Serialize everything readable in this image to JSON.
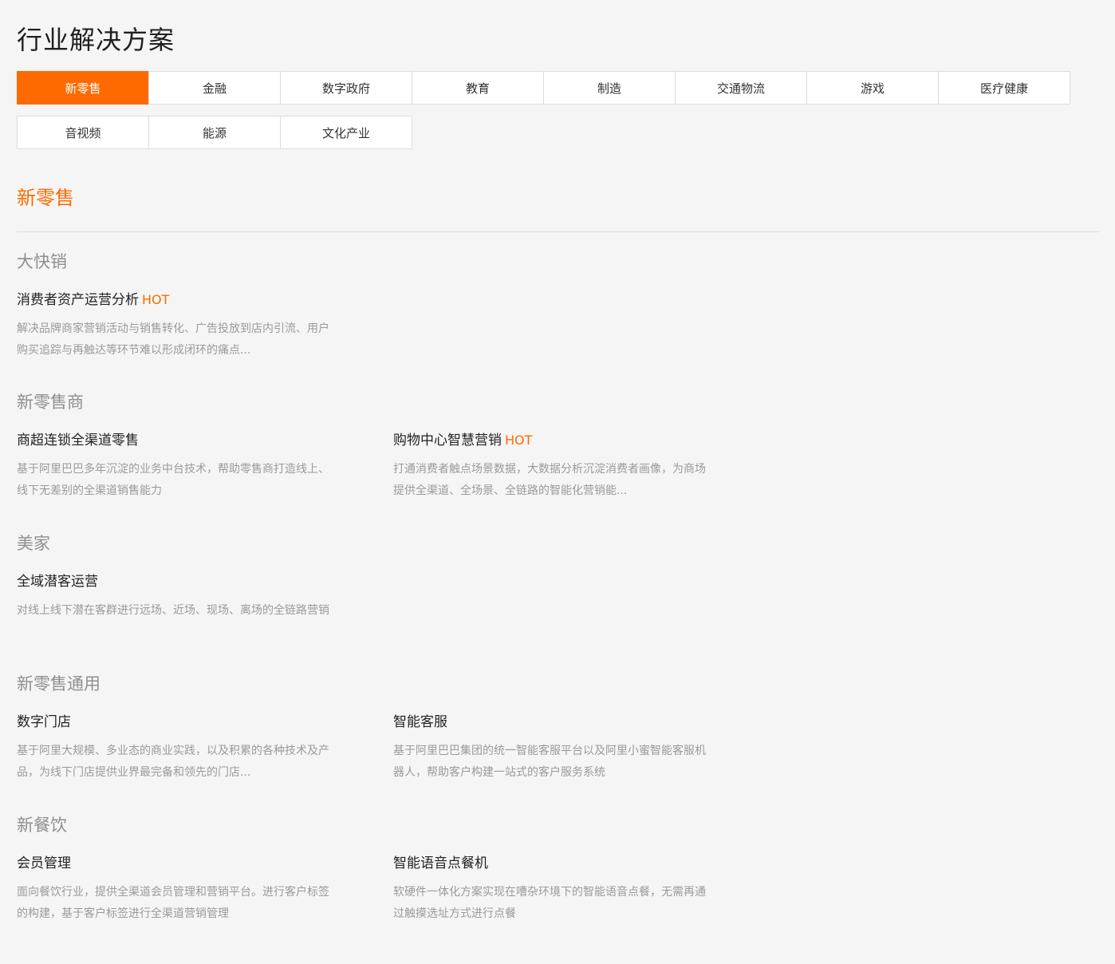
{
  "page": {
    "title": "行业解决方案"
  },
  "tabs": {
    "row1": [
      "新零售",
      "金融",
      "数字政府",
      "教育",
      "制造",
      "交通物流",
      "游戏",
      "医疗健康"
    ],
    "row2": [
      "音视频",
      "能源",
      "文化产业"
    ],
    "active": "新零售"
  },
  "section": {
    "title": "新零售"
  },
  "groups": [
    {
      "title": "大快销",
      "cards": [
        {
          "title": "消费者资产运营分析",
          "hot": "HOT",
          "desc": "解决品牌商家营销活动与销售转化、广告投放到店内引流、用户购买追踪与再触达等环节难以形成闭环的痛点..."
        }
      ]
    },
    {
      "title": "新零售商",
      "cards": [
        {
          "title": "商超连锁全渠道零售",
          "hot": "",
          "desc": "基于阿里巴巴多年沉淀的业务中台技术，帮助零售商打造线上、线下无差别的全渠道销售能力"
        },
        {
          "title": "购物中心智慧营销",
          "hot": "HOT",
          "desc": "打通消费者触点场景数据，大数据分析沉淀消费者画像，为商场提供全渠道、全场景、全链路的智能化营销能..."
        }
      ]
    },
    {
      "title": "美家",
      "cards": [
        {
          "title": "全域潜客运营",
          "hot": "",
          "desc": "对线上线下潜在客群进行远场、近场、现场、离场的全链路营销"
        }
      ]
    },
    {
      "title": "新零售通用",
      "cards": [
        {
          "title": "数字门店",
          "hot": "",
          "desc": "基于阿里大规模、多业态的商业实践，以及积累的各种技术及产品，为线下门店提供业界最完备和领先的门店..."
        },
        {
          "title": "智能客服",
          "hot": "",
          "desc": "基于阿里巴巴集团的统一智能客服平台以及阿里小蜜智能客服机器人，帮助客户构建一站式的客户服务系统"
        }
      ]
    },
    {
      "title": "新餐饮",
      "cards": [
        {
          "title": "会员管理",
          "hot": "",
          "desc": "面向餐饮行业，提供全渠道会员管理和营销平台。进行客户标签的构建，基于客户标签进行全渠道营销管理"
        },
        {
          "title": "智能语音点餐机",
          "hot": "",
          "desc": "软硬件一体化方案实现在嘈杂环境下的智能语音点餐，无需再通过触摸选址方式进行点餐"
        }
      ]
    }
  ]
}
